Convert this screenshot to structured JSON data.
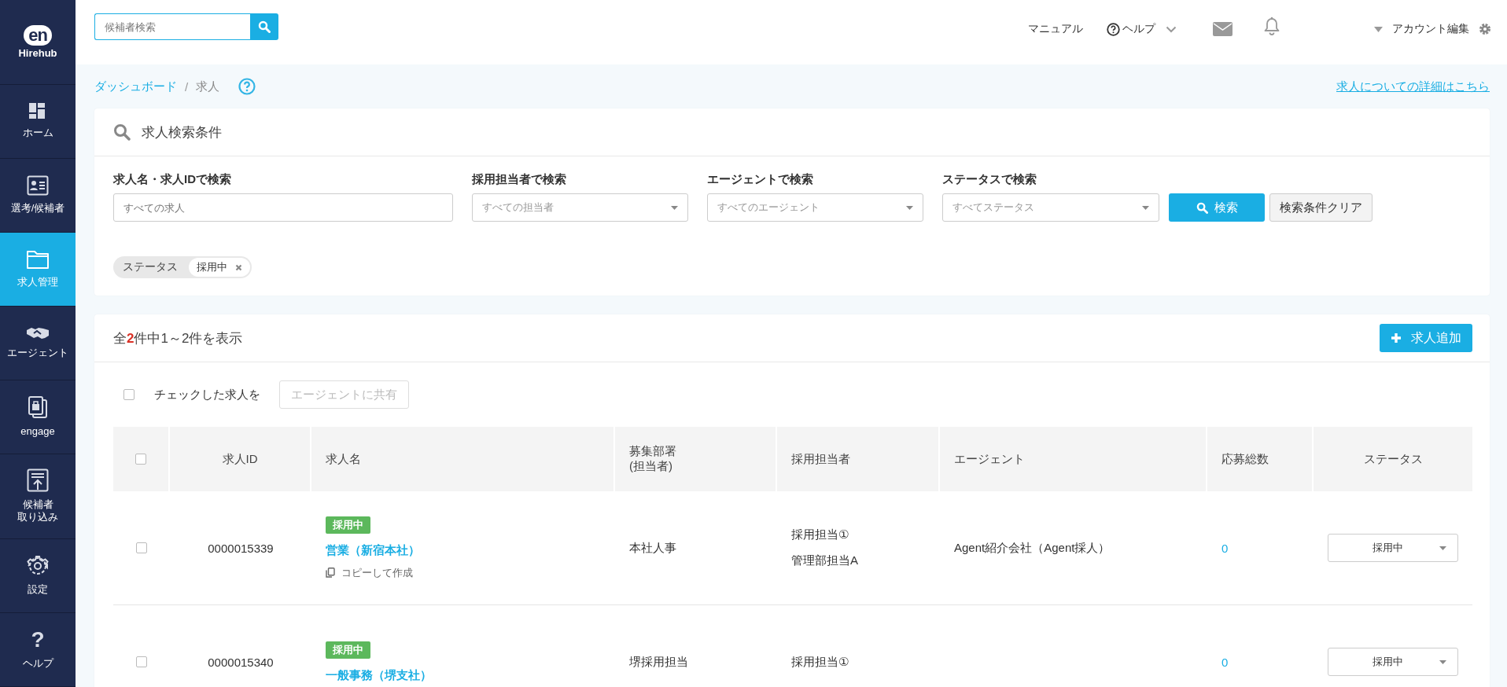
{
  "sidebar": {
    "logo": {
      "mark": "en",
      "name": "Hirehub"
    },
    "items": [
      {
        "kind": "home",
        "label": [
          "ホーム"
        ],
        "selected": false
      },
      {
        "kind": "candidates",
        "label": [
          "選考/候補者"
        ],
        "selected": false
      },
      {
        "kind": "jobs",
        "label": [
          "求人管理"
        ],
        "selected": true
      },
      {
        "kind": "agent",
        "label": [
          "エージェント"
        ],
        "selected": false
      },
      {
        "kind": "engage",
        "label": [
          "engage"
        ],
        "selected": false
      },
      {
        "kind": "import",
        "label": [
          "候補者",
          "取り込み"
        ],
        "selected": false
      },
      {
        "kind": "settings",
        "label": [
          "設定"
        ],
        "selected": false
      },
      {
        "kind": "help",
        "label": [
          "ヘルプ"
        ],
        "selected": false,
        "glyph": "?"
      }
    ]
  },
  "header": {
    "search": {
      "placeholder": "候補者検索"
    },
    "manual": "マニュアル",
    "help": "ヘルプ",
    "account": "アカウント編集"
  },
  "breadcrumb": {
    "items": [
      {
        "label": "ダッシュボード",
        "link": true
      },
      {
        "label": "求人",
        "link": false
      }
    ],
    "separator": "/",
    "detail_link": "求人についての詳細はこちら"
  },
  "search_panel": {
    "title": "求人検索条件",
    "fields": [
      {
        "kind": "text",
        "label": "求人名・求人IDで検索",
        "placeholder": "すべての求人"
      },
      {
        "kind": "select",
        "label": "採用担当者で検索",
        "placeholder": "すべての担当者"
      },
      {
        "kind": "select",
        "label": "エージェントで検索",
        "placeholder": "すべてのエージェント"
      },
      {
        "kind": "select",
        "label": "ステータスで検索",
        "placeholder": "すべてステータス"
      }
    ],
    "search_button": "検索",
    "clear_button": "検索条件クリア",
    "filters": [
      {
        "label": "ステータス",
        "value": "採用中"
      }
    ]
  },
  "results": {
    "summary": "全**2**件中1～2件を表示",
    "add_button": "求人追加",
    "bulk": {
      "checked": false,
      "label": "チェックした求人を",
      "button": "エージェントに共有",
      "disabled": true
    },
    "table": {
      "select_all_checked": false,
      "columns": [
        {
          "lines": [
            "求人ID"
          ]
        },
        {
          "lines": [
            "求人名"
          ]
        },
        {
          "lines": [
            "募集部署",
            "(担当者)"
          ]
        },
        {
          "lines": [
            "採用担当者"
          ]
        },
        {
          "lines": [
            "エージェント"
          ]
        },
        {
          "lines": [
            "応募総数"
          ]
        },
        {
          "lines": [
            "ステータス"
          ]
        }
      ],
      "rows": [
        {
          "checked": false,
          "id": "0000015339",
          "tag": "採用中",
          "name": "営業（新宿本社）",
          "copy": "コピーして作成",
          "department": "本社人事",
          "recruiters": [
            "採用担当①",
            "管理部担当A"
          ],
          "agent": "Agent紹介会社（Agent採人）",
          "applications": "0",
          "status": "採用中"
        },
        {
          "checked": false,
          "id": "0000015340",
          "tag": "採用中",
          "name": "一般事務（堺支社）",
          "department": "堺採用担当",
          "recruiters": [
            "採用担当①"
          ],
          "applications": "0",
          "status": "採用中"
        }
      ]
    }
  }
}
